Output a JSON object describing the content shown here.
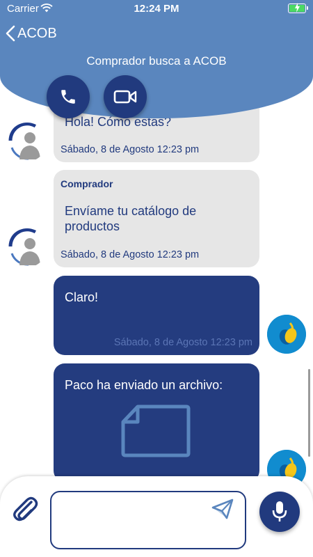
{
  "status_bar": {
    "carrier": "Carrier",
    "time": "12:24 PM"
  },
  "header": {
    "back_label": "ACOB",
    "subtitle": "Comprador busca a ACOB"
  },
  "actions": {
    "call_icon": "phone-icon",
    "video_icon": "video-camera-icon"
  },
  "messages": [
    {
      "direction": "incoming",
      "sender": "",
      "text": "Hola! Cómo estás?",
      "time": "Sábado, 8 de Agosto 12:23 pm"
    },
    {
      "direction": "incoming",
      "sender": "Comprador",
      "text": "Envíame tu catálogo de productos",
      "time": "Sábado, 8 de Agosto 12:23 pm"
    },
    {
      "direction": "outgoing",
      "text": "Claro!",
      "time": "Sábado, 8 de Agosto 12:23 pm"
    },
    {
      "direction": "outgoing",
      "text": "Paco ha enviado un archivo:",
      "attachment_icon": "file-icon"
    }
  ],
  "composer": {
    "placeholder": "",
    "value": "",
    "attach_icon": "paperclip-icon",
    "send_icon": "send-icon",
    "mic_icon": "microphone-icon"
  },
  "colors": {
    "header": "#5a86be",
    "primary": "#213a7e",
    "incoming_bubble": "#e6e6e6",
    "outgoing_bubble": "#243c7f"
  }
}
